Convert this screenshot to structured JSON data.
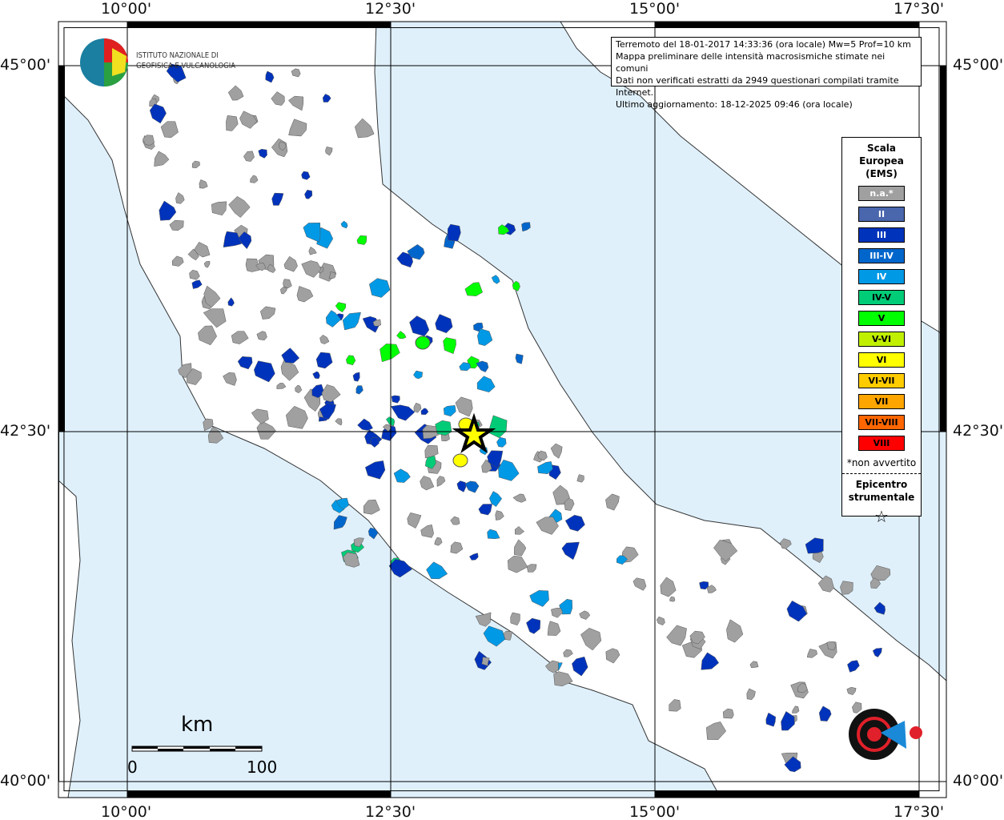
{
  "axes": {
    "lon_labels": [
      "10°00'",
      "12°30'",
      "15°00'",
      "17°30'"
    ],
    "lat_labels": [
      "45°00'",
      "42°30'",
      "40°00'"
    ]
  },
  "info": {
    "line1": "Terremoto del 18-01-2017 14:33:36 (ora locale) Mw=5 Prof=10 km",
    "line2": "Mappa preliminare delle intensità macrosismiche stimate nei comuni",
    "line3": "Dati non verificati estratti da 2949 questionari compilati tramite Internet.",
    "line4": "Ultimo aggiornamento: 18-12-2025 09:46 (ora locale)"
  },
  "legend": {
    "title": "Scala Europea (EMS)",
    "items": [
      {
        "label": "n.a.*",
        "color": "#a0a0a0",
        "text_color": "#ffffff"
      },
      {
        "label": "II",
        "color": "#4a66ad",
        "text_color": "#ffffff"
      },
      {
        "label": "III",
        "color": "#0033bb",
        "text_color": "#ffffff"
      },
      {
        "label": "III-IV",
        "color": "#0066cc",
        "text_color": "#ffffff"
      },
      {
        "label": "IV",
        "color": "#0099e6",
        "text_color": "#ffffff"
      },
      {
        "label": "IV-V",
        "color": "#00cc77",
        "text_color": "#000000"
      },
      {
        "label": "V",
        "color": "#00ff00",
        "text_color": "#000000"
      },
      {
        "label": "V-VI",
        "color": "#c0f000",
        "text_color": "#000000"
      },
      {
        "label": "VI",
        "color": "#ffff00",
        "text_color": "#000000"
      },
      {
        "label": "VI-VII",
        "color": "#ffcc00",
        "text_color": "#000000"
      },
      {
        "label": "VII",
        "color": "#ffa500",
        "text_color": "#000000"
      },
      {
        "label": "VII-VIII",
        "color": "#ff6600",
        "text_color": "#000000"
      },
      {
        "label": "VIII",
        "color": "#ff0000",
        "text_color": "#000000"
      }
    ],
    "note": "*non avvertito",
    "epicenter_label": "Epicentro strumentale",
    "epicenter_icon": "star-icon"
  },
  "scale_bar": {
    "unit": "km",
    "start": "0",
    "end": "100"
  },
  "logos": {
    "ingv": "ISTITUTO NAZIONALE DI GEOFISICA E VULCANOLOGIA",
    "hsit": "www.haisentitoilterremoto.it"
  },
  "colors": {
    "sea": "#dff0fb",
    "land": "#ffffff",
    "na": "#a0a0a0"
  }
}
